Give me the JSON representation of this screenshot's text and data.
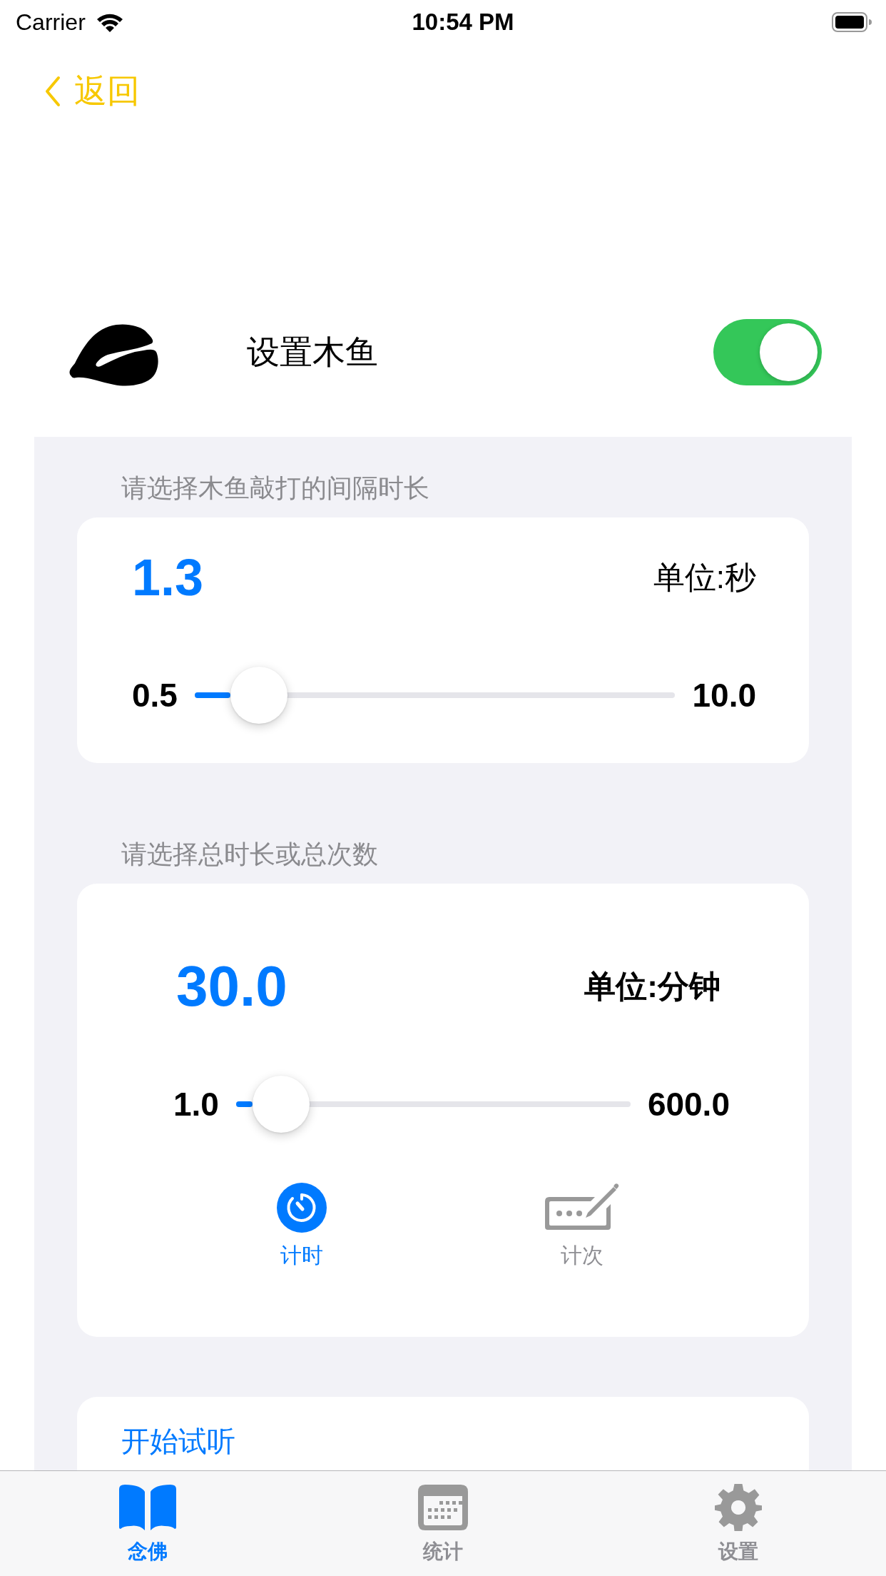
{
  "status_bar": {
    "carrier": "Carrier",
    "time": "10:54 PM"
  },
  "nav": {
    "back": "返回"
  },
  "muyu": {
    "title": "设置木鱼",
    "on": true
  },
  "interval": {
    "label": "请选择木鱼敲打的间隔时长",
    "value": "1.3",
    "unit": "单位:秒",
    "min": "0.5",
    "max": "10.0",
    "level": 0.084
  },
  "total": {
    "label": "请选择总时长或总次数",
    "value": "30.0",
    "unit": "单位:分钟",
    "min": "1.0",
    "max": "600.0",
    "level": 0.048,
    "modes": [
      {
        "kind": "timer",
        "label": "计时",
        "selected": true
      },
      {
        "kind": "counter",
        "label": "计次",
        "selected": false
      }
    ]
  },
  "preview": {
    "label": "开始试听"
  },
  "tabs": [
    {
      "kind": "book",
      "label": "念佛",
      "selected": true
    },
    {
      "kind": "calendar",
      "label": "统计",
      "selected": false
    },
    {
      "kind": "gear",
      "label": "设置",
      "selected": false
    }
  ]
}
